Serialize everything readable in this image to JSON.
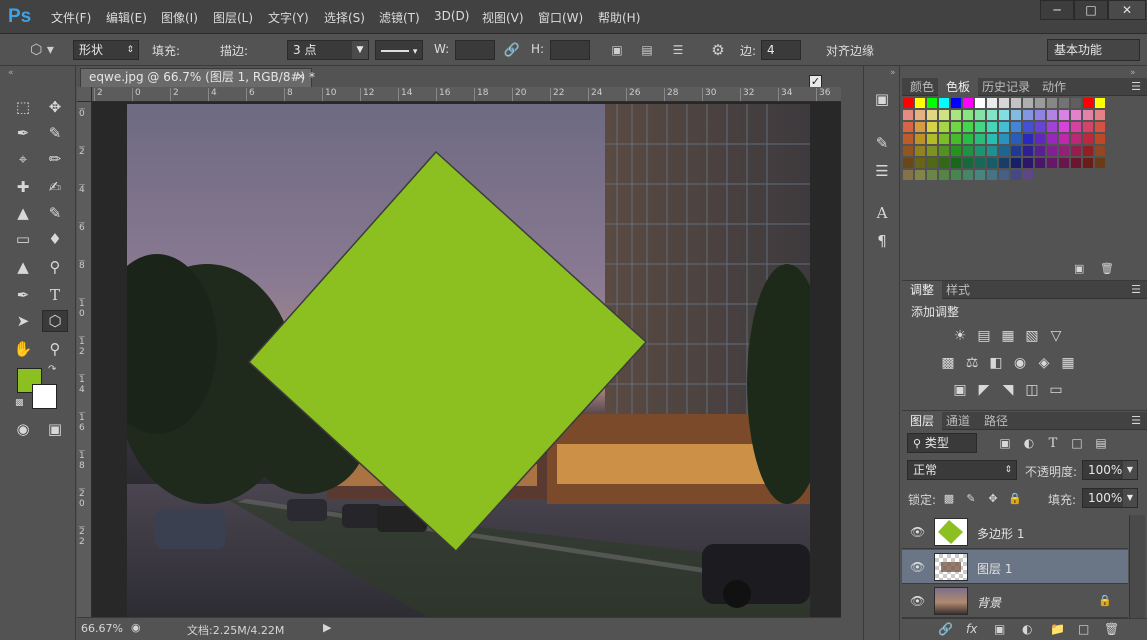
{
  "app": {
    "logo": "Ps"
  },
  "menu": [
    "文件(F)",
    "编辑(E)",
    "图像(I)",
    "图层(L)",
    "文字(Y)",
    "选择(S)",
    "滤镜(T)",
    "3D(D)",
    "视图(V)",
    "窗口(W)",
    "帮助(H)"
  ],
  "options": {
    "mode": "形状",
    "fill_label": "填充:",
    "fill_color": "#8cc020",
    "stroke_label": "描边:",
    "stroke_width": "3 点",
    "w_label": "W:",
    "h_label": "H:",
    "sides_label": "边:",
    "sides_value": "4",
    "align_edges_label": "对齐边缘",
    "workspace": "基本功能"
  },
  "document": {
    "tab_title": "eqwe.jpg @ 66.7% (图层 1, RGB/8#) *",
    "zoom": "66.67%",
    "doc_info": "文档:2.25M/4.22M",
    "hruler_ticks": [
      "2",
      "0",
      "2",
      "4",
      "6",
      "8",
      "10",
      "12",
      "14",
      "16",
      "18",
      "20",
      "22",
      "24",
      "26",
      "28",
      "30",
      "32",
      "34",
      "36"
    ],
    "vruler_ticks": [
      "0",
      "2",
      "4",
      "6",
      "8",
      "1\n0",
      "1\n2",
      "1\n4",
      "1\n6",
      "1\n8",
      "2\n0",
      "2\n2"
    ]
  },
  "tools": {
    "foreground_color": "#8cc020",
    "background_color": "#ffffff"
  },
  "swatch_panel": {
    "tabs": [
      "颜色",
      "色板",
      "历史记录",
      "动作"
    ],
    "active_tab": "色板"
  },
  "adjust_panel": {
    "tabs": [
      "调整",
      "样式"
    ],
    "active_tab": "调整",
    "title": "添加调整"
  },
  "layers_panel": {
    "tabs": [
      "图层",
      "通道",
      "路径"
    ],
    "active_tab": "图层",
    "filter_kind": "类型",
    "blend_mode": "正常",
    "opacity_label": "不透明度:",
    "opacity": "100%",
    "lock_label": "锁定:",
    "fill_label": "填充:",
    "fill": "100%",
    "layers": [
      {
        "name": "多边形 1",
        "selected": false
      },
      {
        "name": "图层 1",
        "selected": true
      },
      {
        "name": "背景",
        "selected": false
      }
    ]
  }
}
